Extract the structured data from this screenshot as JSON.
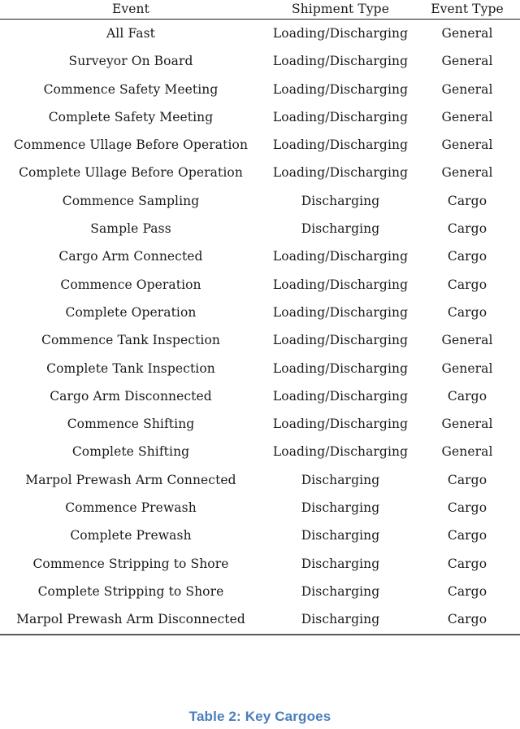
{
  "table": {
    "columns": [
      "Event",
      "Shipment Type",
      "Event Type"
    ],
    "rows": [
      {
        "event": "All Fast",
        "shipment_type": "Loading/Discharging",
        "event_type": "General"
      },
      {
        "event": "Surveyor On Board",
        "shipment_type": "Loading/Discharging",
        "event_type": "General"
      },
      {
        "event": "Commence Safety Meeting",
        "shipment_type": "Loading/Discharging",
        "event_type": "General"
      },
      {
        "event": "Complete Safety Meeting",
        "shipment_type": "Loading/Discharging",
        "event_type": "General"
      },
      {
        "event": "Commence Ullage Before Operation",
        "shipment_type": "Loading/Discharging",
        "event_type": "General"
      },
      {
        "event": "Complete Ullage Before Operation",
        "shipment_type": "Loading/Discharging",
        "event_type": "General"
      },
      {
        "event": "Commence Sampling",
        "shipment_type": "Discharging",
        "event_type": "Cargo"
      },
      {
        "event": "Sample Pass",
        "shipment_type": "Discharging",
        "event_type": "Cargo"
      },
      {
        "event": "Cargo Arm Connected",
        "shipment_type": "Loading/Discharging",
        "event_type": "Cargo"
      },
      {
        "event": "Commence Operation",
        "shipment_type": "Loading/Discharging",
        "event_type": "Cargo"
      },
      {
        "event": "Complete Operation",
        "shipment_type": "Loading/Discharging",
        "event_type": "Cargo"
      },
      {
        "event": "Commence Tank Inspection",
        "shipment_type": "Loading/Discharging",
        "event_type": "General"
      },
      {
        "event": "Complete Tank Inspection",
        "shipment_type": "Loading/Discharging",
        "event_type": "General"
      },
      {
        "event": "Cargo Arm Disconnected",
        "shipment_type": "Loading/Discharging",
        "event_type": "Cargo"
      },
      {
        "event": "Commence Shifting",
        "shipment_type": "Loading/Discharging",
        "event_type": "General"
      },
      {
        "event": "Complete Shifting",
        "shipment_type": "Loading/Discharging",
        "event_type": "General"
      },
      {
        "event": "Marpol Prewash Arm Connected",
        "shipment_type": "Discharging",
        "event_type": "Cargo"
      },
      {
        "event": "Commence Prewash",
        "shipment_type": "Discharging",
        "event_type": "Cargo"
      },
      {
        "event": "Complete Prewash",
        "shipment_type": "Discharging",
        "event_type": "Cargo"
      },
      {
        "event": "Commence Stripping to Shore",
        "shipment_type": "Discharging",
        "event_type": "Cargo"
      },
      {
        "event": "Complete Stripping to Shore",
        "shipment_type": "Discharging",
        "event_type": "Cargo"
      },
      {
        "event": "Marpol Prewash Arm Disconnected",
        "shipment_type": "Discharging",
        "event_type": "Cargo"
      }
    ]
  },
  "caption": {
    "text": "Table 2: Key Cargoes",
    "color": "#4a7ebb"
  },
  "colors": {
    "text": "#1a1a1a",
    "rule_top": "#1b1b1b",
    "rule_bottom": "#555a5e",
    "background": "#ffffff",
    "caption": "#4a7ebb"
  }
}
